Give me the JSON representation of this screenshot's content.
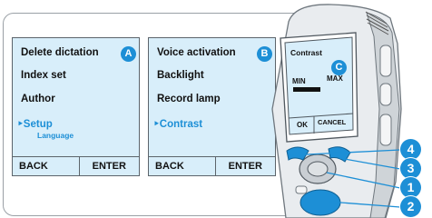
{
  "menu1": {
    "items": [
      "Delete dictation",
      "Index set",
      "Author",
      "Setup"
    ],
    "selected_marker": "‣",
    "sub_label": "Language",
    "badge": "A",
    "softkeys": [
      "BACK",
      "ENTER"
    ]
  },
  "menu2": {
    "items": [
      "Voice activation",
      "Backlight",
      "Record lamp",
      "Contrast"
    ],
    "selected_marker": "‣",
    "badge": "B",
    "softkeys": [
      "BACK",
      "ENTER"
    ]
  },
  "device": {
    "screen_title": "Contrast",
    "min_label": "MIN",
    "max_label": "MAX",
    "ok_label": "OK",
    "cancel_label": "CANCEL",
    "badge": "C"
  },
  "callouts": [
    "4",
    "3",
    "1",
    "2"
  ],
  "colors": {
    "accent": "#1d8fd6",
    "screen_bg": "#d8eefa"
  }
}
